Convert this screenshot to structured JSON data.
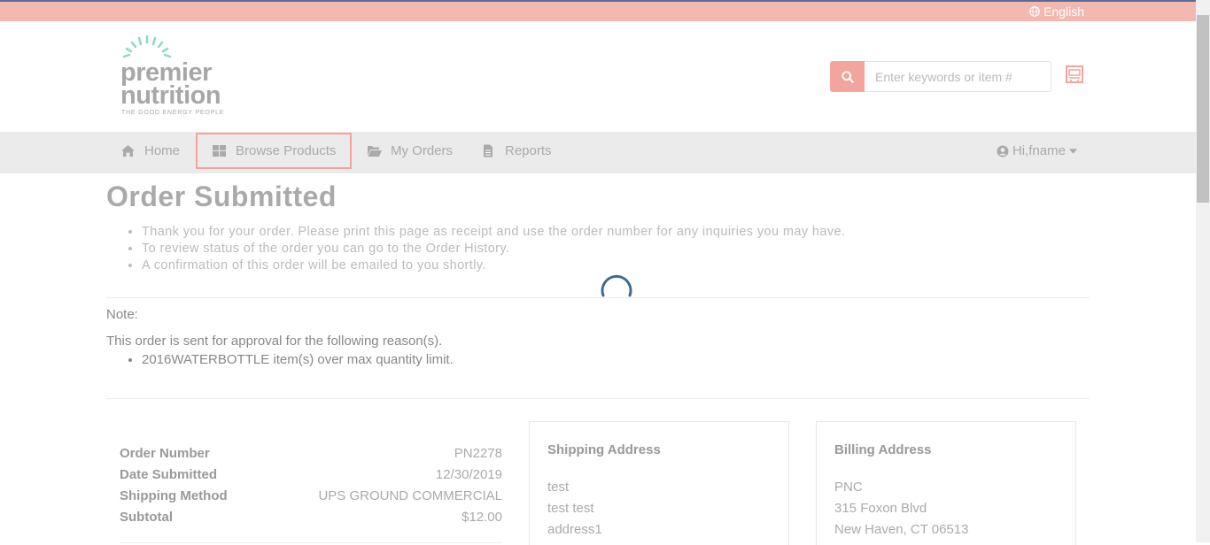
{
  "topbar": {
    "language_label": "English"
  },
  "logo": {
    "line1": "premier",
    "line2": "nutrition",
    "tagline": "THE GOOD ENERGY PEOPLE"
  },
  "search": {
    "placeholder": "Enter keywords or item #"
  },
  "nav": {
    "items": [
      {
        "label": "Home",
        "icon": "home-icon"
      },
      {
        "label": "Browse Products",
        "icon": "grid-icon"
      },
      {
        "label": "My Orders",
        "icon": "folder-open-icon"
      },
      {
        "label": "Reports",
        "icon": "file-icon"
      }
    ],
    "user_label": "Hi,fname"
  },
  "page": {
    "title": "Order Submitted",
    "bullets": [
      "Thank you for your order. Please print this page as receipt and use the order number for any inquiries you may have.",
      "To review status of the order you can go to the Order History.",
      "A confirmation of this order will be emailed to you shortly."
    ],
    "note_label": "Note:",
    "note_text": "This order is sent for approval for the following reason(s).",
    "reasons": [
      "2016WATERBOTTLE item(s) over max quantity limit."
    ]
  },
  "summary": {
    "rows": [
      {
        "label": "Order Number",
        "value": "PN2278"
      },
      {
        "label": "Date Submitted",
        "value": "12/30/2019"
      },
      {
        "label": "Shipping Method",
        "value": "UPS GROUND COMMERCIAL"
      },
      {
        "label": "Subtotal",
        "value": "$12.00"
      }
    ]
  },
  "shipping": {
    "title": "Shipping Address",
    "lines": [
      "test",
      "test test",
      "address1"
    ]
  },
  "billing": {
    "title": "Billing Address",
    "lines": [
      "PNC",
      "315 Foxon Blvd",
      "New Haven, CT 06513"
    ]
  },
  "colors": {
    "accent": "#f3a49c",
    "topbar": "#f3b8b0",
    "nav_bg": "#ebebeb",
    "spinner": "#3f6a93"
  }
}
